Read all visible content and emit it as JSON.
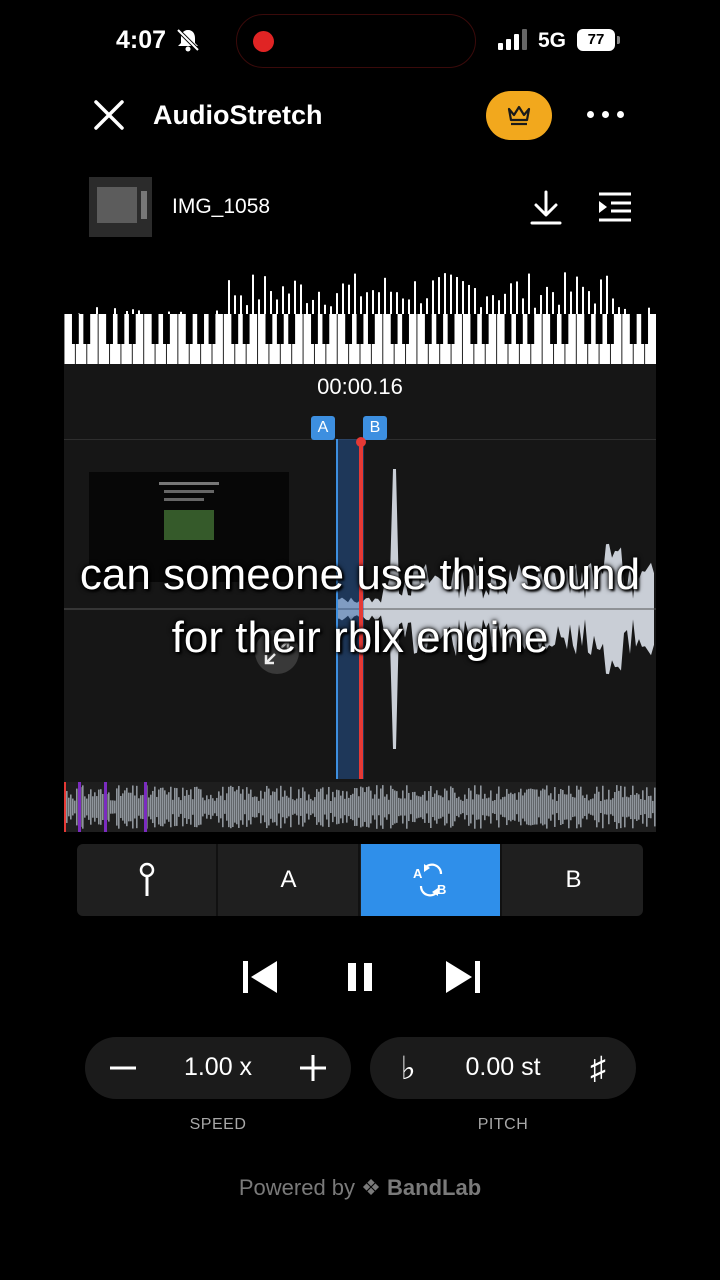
{
  "status_bar": {
    "time": "4:07",
    "network": "5G",
    "battery": "77"
  },
  "header": {
    "title": "AudioStretch"
  },
  "file": {
    "name": "IMG_1058"
  },
  "timeline": {
    "time": "00:00.16",
    "marker_a": "A",
    "marker_b": "B"
  },
  "caption": {
    "text": "can someone use this sound for their rblx engine"
  },
  "segmented": {
    "a_label": "A",
    "b_label": "B",
    "active": "loop-ab"
  },
  "speed": {
    "value": "1.00 x",
    "label": "SPEED"
  },
  "pitch": {
    "value": "0.00 st",
    "label": "PITCH",
    "flat_symbol": "♭",
    "sharp_symbol": "♯"
  },
  "footer": {
    "powered_by": "Powered by",
    "brand": "BandLab"
  },
  "colors": {
    "accent": "#2f8fea",
    "premium": "#f2a81d",
    "playhead": "#e53935"
  }
}
